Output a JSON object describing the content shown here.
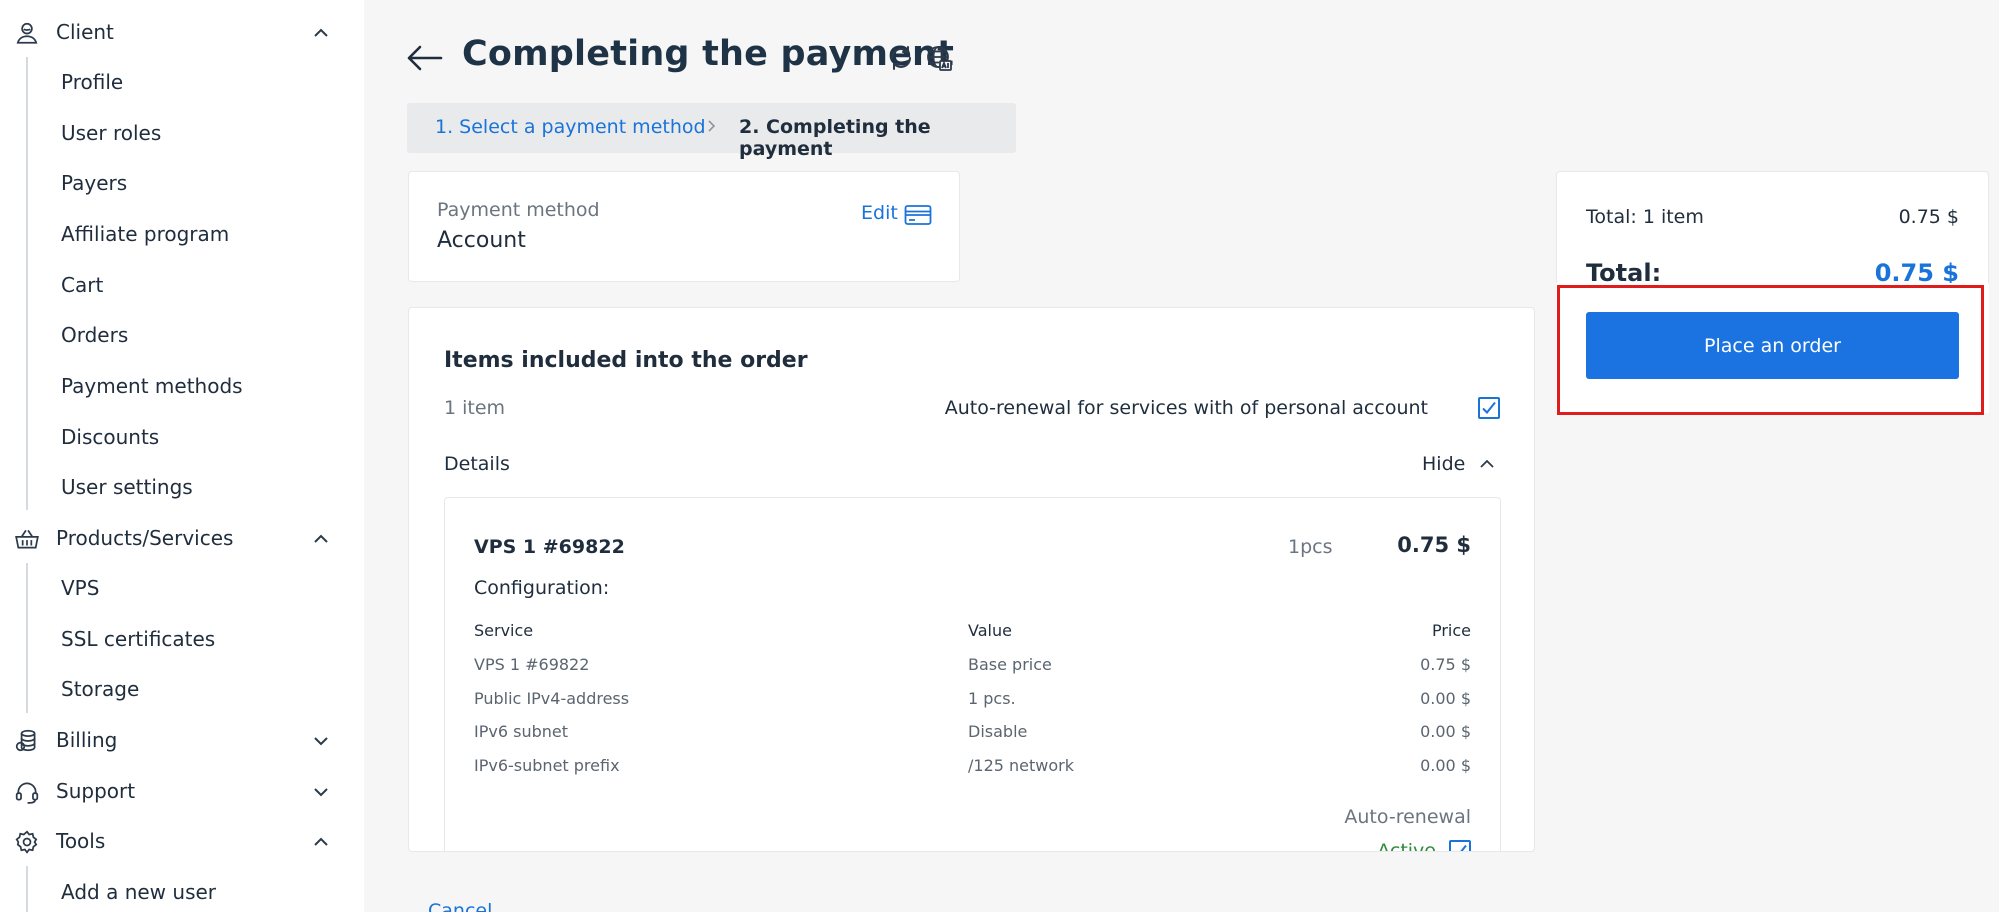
{
  "sidebar": {
    "sections": [
      {
        "label": "Client",
        "icon": "user-icon",
        "expanded": true
      },
      {
        "label": "Products/Services",
        "icon": "basket-icon",
        "expanded": true
      },
      {
        "label": "Billing",
        "icon": "coins-icon",
        "expanded": false
      },
      {
        "label": "Support",
        "icon": "headset-icon",
        "expanded": false
      },
      {
        "label": "Tools",
        "icon": "gear-icon",
        "expanded": true
      }
    ],
    "client_items": [
      "Profile",
      "User roles",
      "Payers",
      "Affiliate program",
      "Cart",
      "Orders",
      "Payment methods",
      "Discounts",
      "User settings"
    ],
    "products_items": [
      "VPS",
      "SSL certificates",
      "Storage"
    ],
    "tools_items": [
      "Add a new user"
    ]
  },
  "header": {
    "title": "Completing the payment",
    "back_icon": "arrow-left-icon",
    "refresh_icon": "refresh-icon",
    "language_icon": "globe-icon"
  },
  "breadcrumb": {
    "step1": "1. Select a payment method",
    "step2": "2. Completing the payment"
  },
  "payment_method": {
    "label": "Payment method",
    "value": "Account",
    "edit_label": "Edit",
    "edit_icon": "credit-card-icon"
  },
  "order": {
    "title": "Items included into the order",
    "count": "1 item",
    "auto_renewal_label": "Auto-renewal for services with of personal account",
    "auto_renewal_checked": true,
    "details_label": "Details",
    "hide_label": "Hide",
    "item": {
      "name": "VPS 1 #69822",
      "qty": "1pcs",
      "price": "0.75 $",
      "config_label": "Configuration:",
      "columns": [
        "Service",
        "Value",
        "Price"
      ],
      "rows": [
        [
          "VPS 1 #69822",
          "Base price",
          "0.75 $"
        ],
        [
          "Public IPv4-address",
          "1 pcs.",
          "0.00 $"
        ],
        [
          "IPv6 subnet",
          "Disable",
          "0.00 $"
        ],
        [
          "IPv6-subnet prefix",
          "/125 network",
          "0.00 $"
        ]
      ],
      "auto_renewal_label": "Auto-renewal",
      "auto_renewal_status": "Active",
      "auto_renewal_checked": true
    },
    "cancel_label": "Cancel"
  },
  "summary": {
    "line_label": "Total: 1 item",
    "line_value": "0.75 $",
    "total_label": "Total:",
    "total_value": "0.75 $",
    "button_label": "Place an order"
  },
  "colors": {
    "accent": "#1a73e0",
    "link": "#1a73d9",
    "highlight": "#e01d1d",
    "active_status": "#2e8b3a"
  }
}
